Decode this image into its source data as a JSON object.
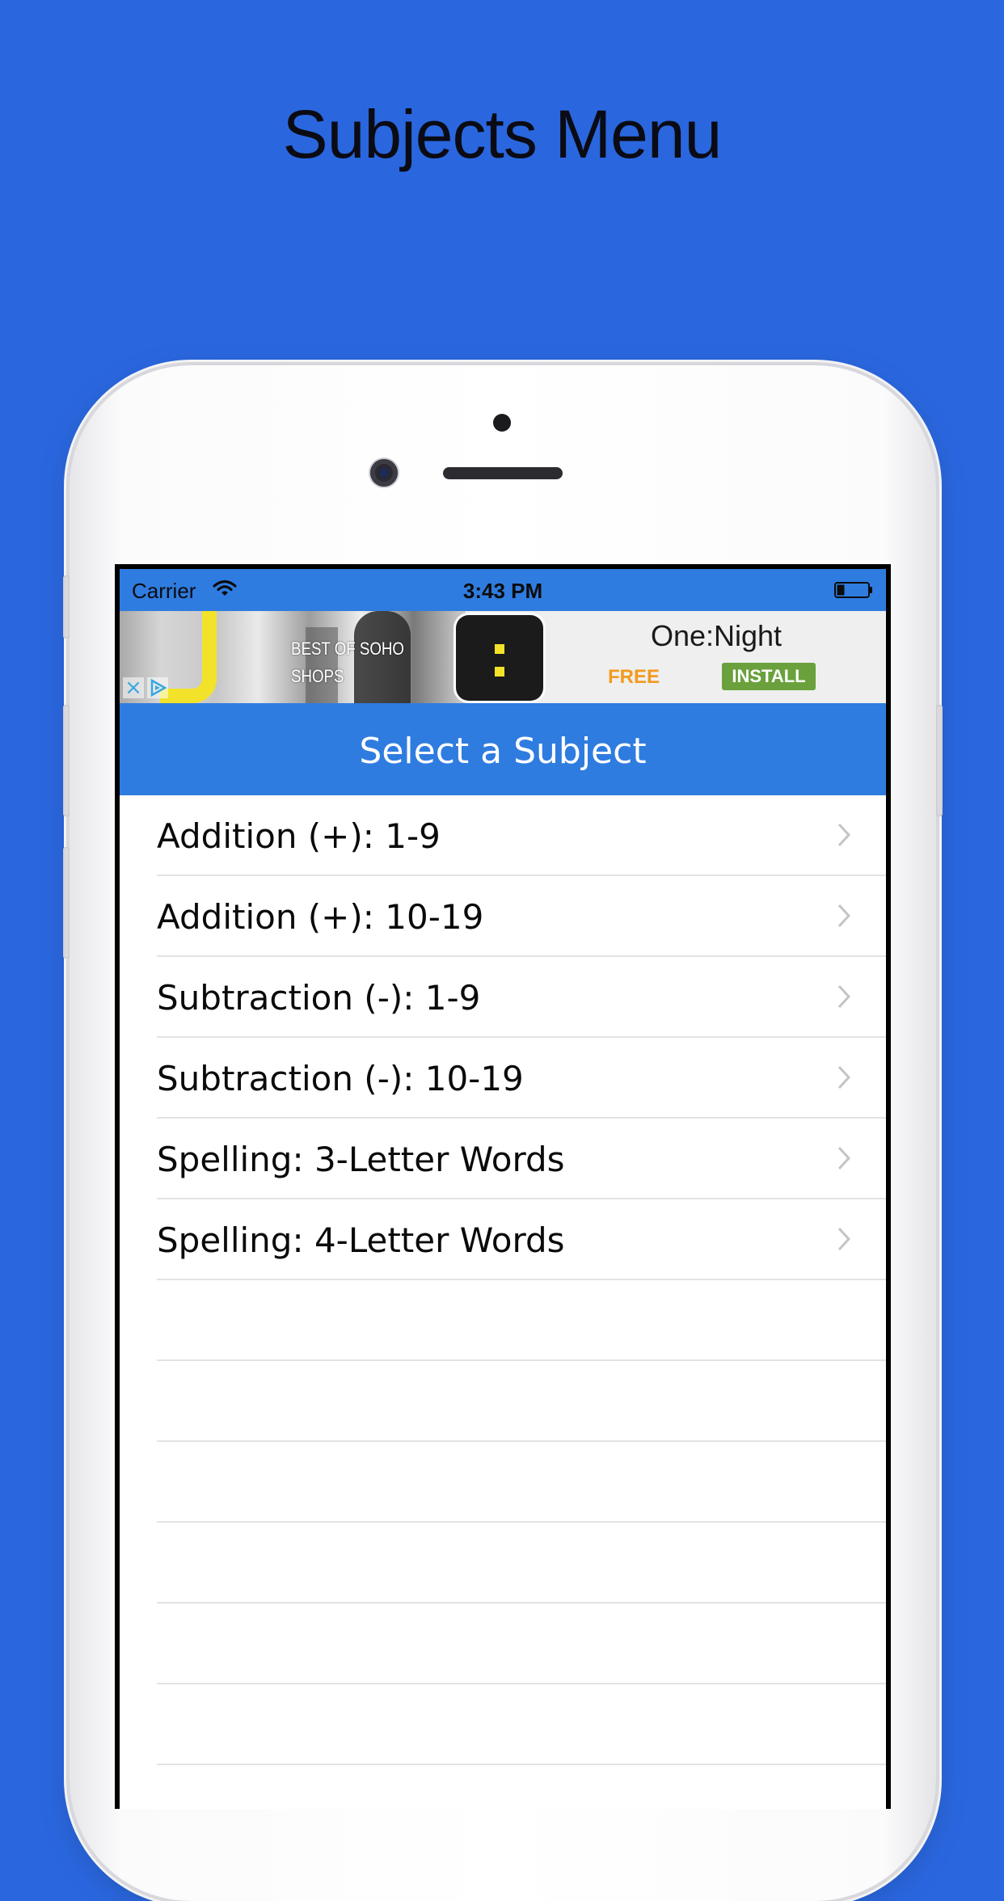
{
  "page": {
    "title": "Subjects Menu",
    "background_color": "#2a67df"
  },
  "status_bar": {
    "carrier": "Carrier",
    "time": "3:43 PM",
    "wifi_icon": "wifi-icon",
    "battery_icon": "battery-icon",
    "color": "#2f7ce0"
  },
  "ad": {
    "photo_text_1": "BEST OF SOHO",
    "photo_text_2": "SHOPS",
    "app_name": "One:Night",
    "price": "FREE",
    "install_label": "INSTALL",
    "close_icon": "close-icon",
    "adchoices_icon": "adchoices-icon"
  },
  "nav": {
    "title": "Select a Subject",
    "color": "#2f7ce0"
  },
  "subjects": [
    {
      "label": "Addition (+): 1-9"
    },
    {
      "label": "Addition (+): 10-19"
    },
    {
      "label": "Subtraction (-): 1-9"
    },
    {
      "label": "Subtraction (-): 10-19"
    },
    {
      "label": "Spelling: 3-Letter Words"
    },
    {
      "label": "Spelling: 4-Letter Words"
    }
  ]
}
